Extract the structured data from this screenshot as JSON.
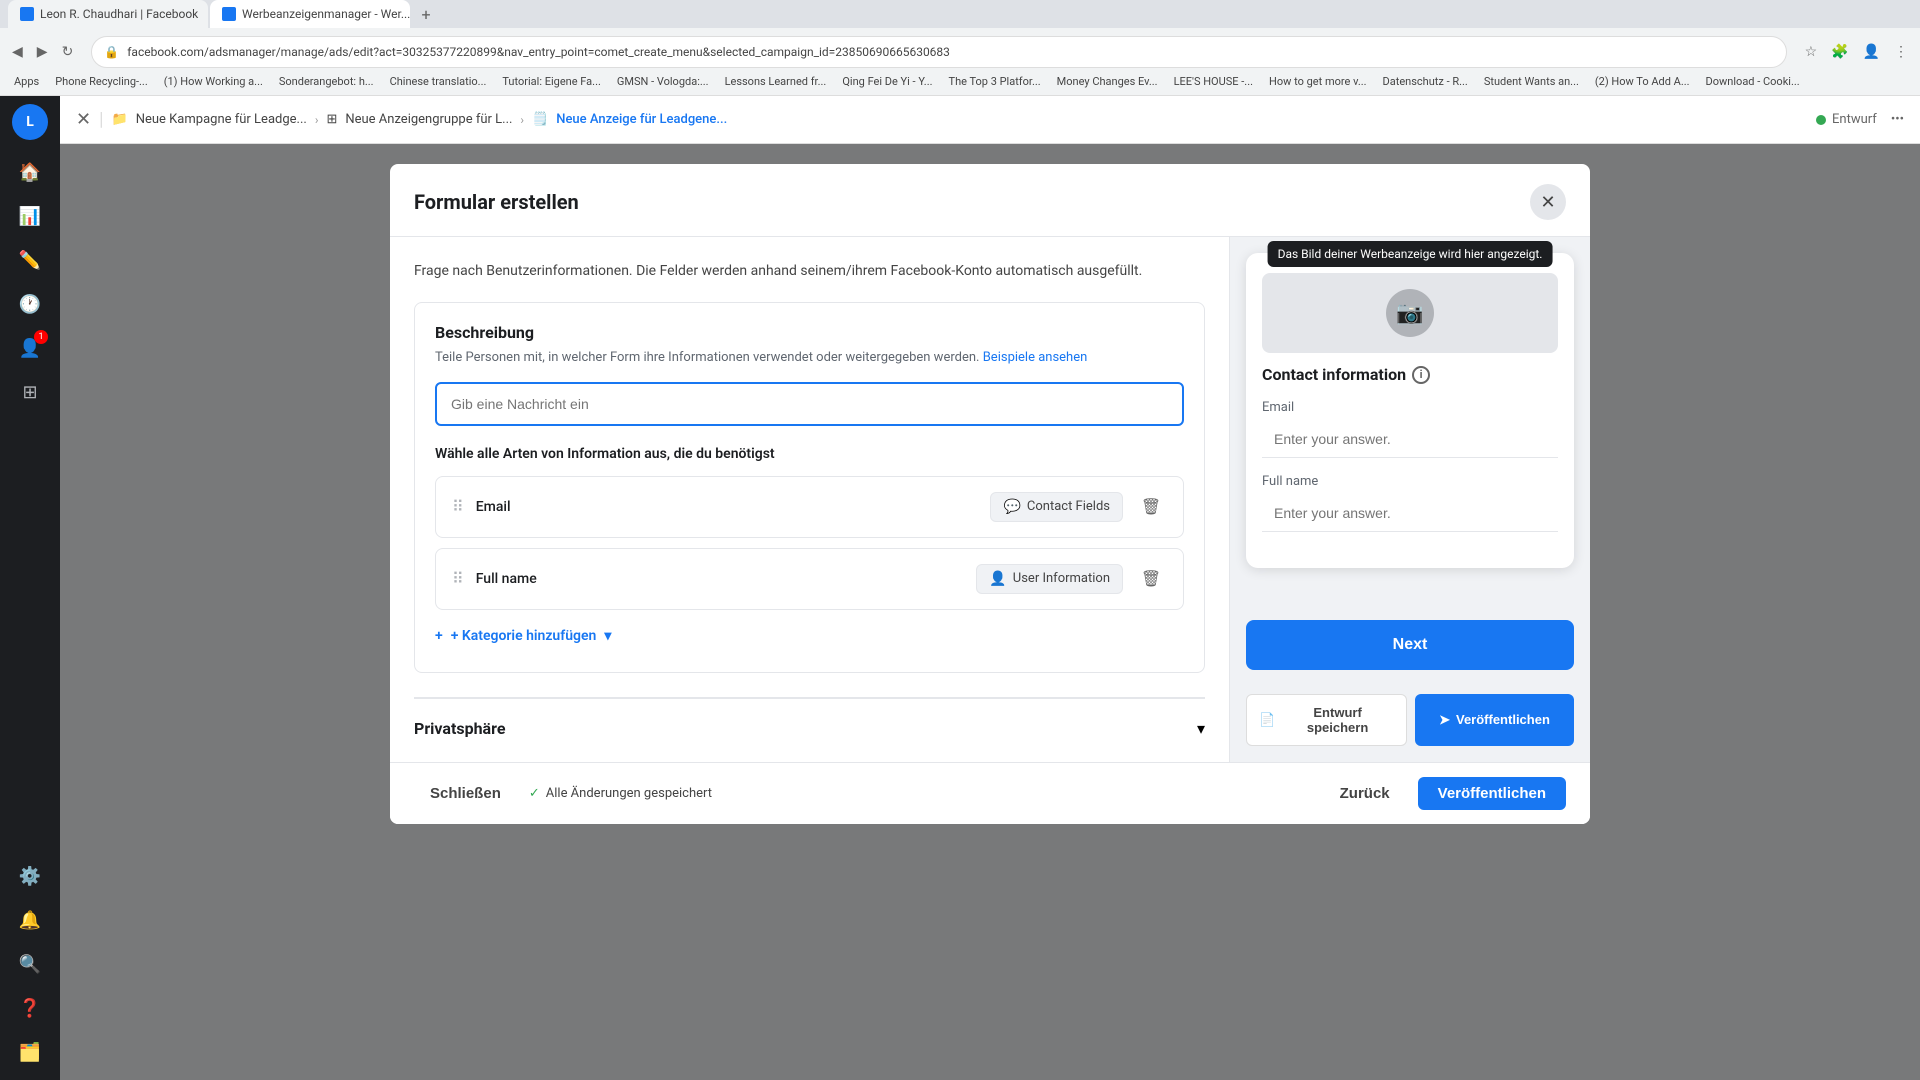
{
  "browser": {
    "tabs": [
      {
        "label": "Leon R. Chaudhari | Facebook",
        "active": false
      },
      {
        "label": "Werbeanzeigenmanager - Wer...",
        "active": true
      }
    ],
    "new_tab_label": "+",
    "address": "facebook.com/adsmanager/manage/ads/edit?act=30325377220899&nav_entry_point=comet_create_menu&selected_campaign_id=23850690665630683",
    "bookmarks": [
      "Apps",
      "Phone Recycling-...",
      "(1) How Working a...",
      "Sonderangebot: h...",
      "Chinese translatio...",
      "Tutorial: Eigene Fa...",
      "GMSN - Vologda:...",
      "Lessons Learned fr...",
      "Qing Fei De Yi - Y...",
      "The Top 3 Platfor...",
      "Money Changes Ev...",
      "LEE'S HOUSE -...",
      "How to get more v...",
      "Datenschutz - R...",
      "Student Wants an...",
      "(2) How To Add A...",
      "Download - Cooki..."
    ]
  },
  "sidebar": {
    "home_icon": "🏠",
    "chart_icon": "📊",
    "edit_icon": "✏️",
    "clock_icon": "🕐",
    "avatar_label": "L",
    "notification_badge": "1",
    "grid_icon": "⊞",
    "settings_icon": "⚙️",
    "bell_icon": "🔔",
    "search_icon": "🔍",
    "help_icon": "❓",
    "sidebar_bottom_icon": "🗂️"
  },
  "breadcrumb": {
    "items": [
      {
        "label": "Neue Kampagne für Leadge...",
        "icon": "📁"
      },
      {
        "label": "Neue Anzeigengruppe für L...",
        "icon": "⊞"
      },
      {
        "label": "Neue Anzeige für Leadgene...",
        "icon": "🗒️",
        "active": true
      }
    ],
    "status_label": "Entwurf",
    "more_icon": "•••"
  },
  "modal": {
    "title": "Formular erstellen",
    "close_icon": "✕",
    "description_section": {
      "title": "Beschreibung",
      "desc_text": "Teile Personen mit, in welcher Form ihre Informationen verwendet oder weitergegeben werden.",
      "desc_link": "Beispiele ansehen",
      "input_placeholder": "Gib eine Nachricht ein"
    },
    "info_select_label": "Wähle alle Arten von Information aus, die du benötigst",
    "fields": [
      {
        "name": "Email",
        "type_label": "Contact Fields",
        "type_icon": "💬"
      },
      {
        "name": "Full name",
        "type_label": "User Information",
        "type_icon": "👤"
      }
    ],
    "add_category_label": "+ Kategorie hinzufügen",
    "add_category_arrow": "▾",
    "privacy_title": "Privatsphäre",
    "privacy_chevron": "▾",
    "form_modal_desc": "Frage nach Benutzerinformationen. Die Felder werden anhand seinem/ihrem Facebook-Konto automatisch ausgefüllt."
  },
  "bottom_bar": {
    "close_label": "Schließen",
    "saved_check": "✓",
    "saved_label": "Alle Änderungen gespeichert",
    "back_label": "Zurück",
    "veroffentlichen_outline_label": "Veröffentlichen",
    "veroffentlichen_fill_label": "Veröffentlichen"
  },
  "preview": {
    "tooltip": "Das Bild deiner Werbeanzeige wird hier angezeigt.",
    "contact_title": "Contact information",
    "info_label": "i",
    "email_label": "Email",
    "email_placeholder": "Enter your answer.",
    "fullname_label": "Full name",
    "fullname_placeholder": "Enter your answer.",
    "next_button": "Next",
    "entwurf_icon": "📄",
    "entwurf_label": "Entwurf speichern",
    "publish_icon": "➤",
    "publish_label": "Veröffentlichen"
  }
}
